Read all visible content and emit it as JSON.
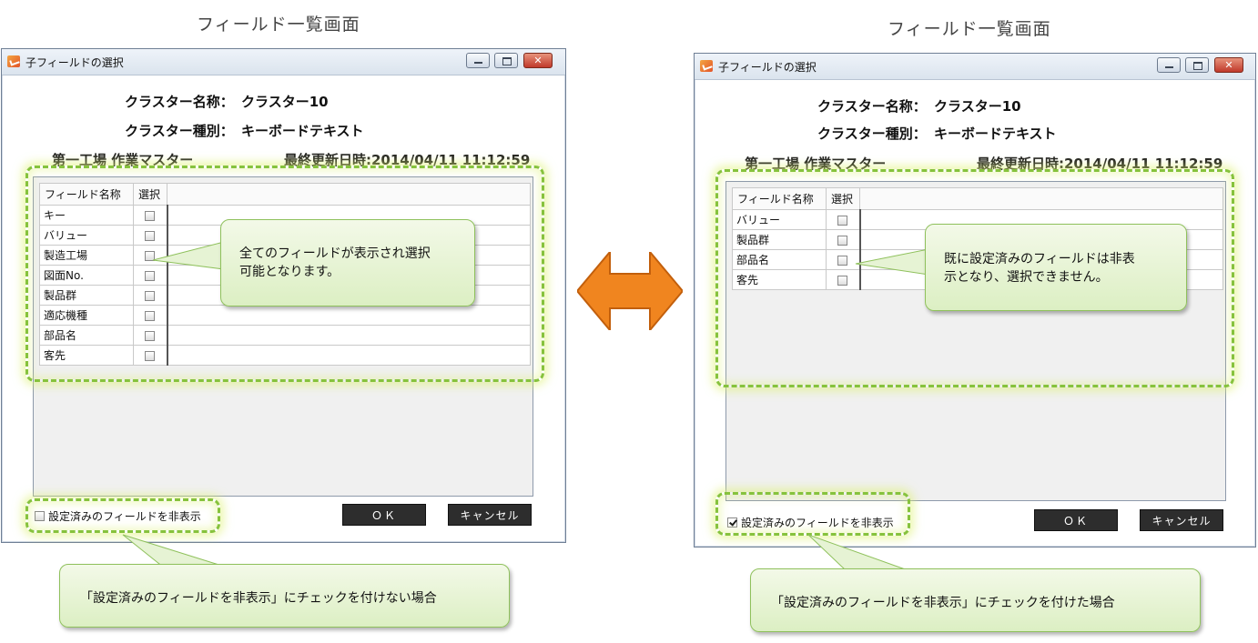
{
  "left": {
    "caption": "フィールド一覧画面",
    "window_title": "子フィールドの選択",
    "cluster_name_label": "クラスター名称：",
    "cluster_name_value": "クラスター10",
    "cluster_type_label": "クラスター種別：",
    "cluster_type_value": "キーボードテキスト",
    "source_name": "第一工場 作業マスター",
    "last_updated": "最終更新日時:2014/04/11 11:12:59",
    "table_headers": [
      "フィールド名称",
      "選択"
    ],
    "rows": [
      "キー",
      "バリュー",
      "製造工場",
      "図面No.",
      "製品群",
      "適応機種",
      "部品名",
      "客先"
    ],
    "hide_configured_label": "設定済みのフィールドを非表示",
    "hide_configured_checked": false,
    "ok_label": "ＯＫ",
    "cancel_label": "キャンセル",
    "callout_text": "全てのフィールドが表示され選択可能となります。",
    "callout_line1": "全てのフィールドが表示され選択",
    "callout_line2": "可能となります。",
    "bottom_callout": "「設定済みのフィールドを非表示」にチェックを付けない場合"
  },
  "right": {
    "caption": "フィールド一覧画面",
    "window_title": "子フィールドの選択",
    "cluster_name_label": "クラスター名称：",
    "cluster_name_value": "クラスター10",
    "cluster_type_label": "クラスター種別：",
    "cluster_type_value": "キーボードテキスト",
    "source_name": "第一工場 作業マスター",
    "last_updated": "最終更新日時:2014/04/11 11:12:59",
    "table_headers": [
      "フィールド名称",
      "選択"
    ],
    "rows": [
      "バリュー",
      "製品群",
      "部品名",
      "客先"
    ],
    "hide_configured_label": "設定済みのフィールドを非表示",
    "hide_configured_checked": true,
    "ok_label": "ＯＫ",
    "cancel_label": "キャンセル",
    "callout_line1": "既に設定済みのフィールドは非表",
    "callout_line2": "示となり、選択できません。",
    "bottom_callout": "「設定済みのフィールドを非表示」にチェックを付けた場合"
  },
  "colors": {
    "highlight_dash": "#86c23d",
    "arrow": "#f0851f",
    "button_bg": "#2d2d2d"
  },
  "icons": {
    "double_arrow": "double-arrow-icon",
    "app": "app-icon"
  }
}
